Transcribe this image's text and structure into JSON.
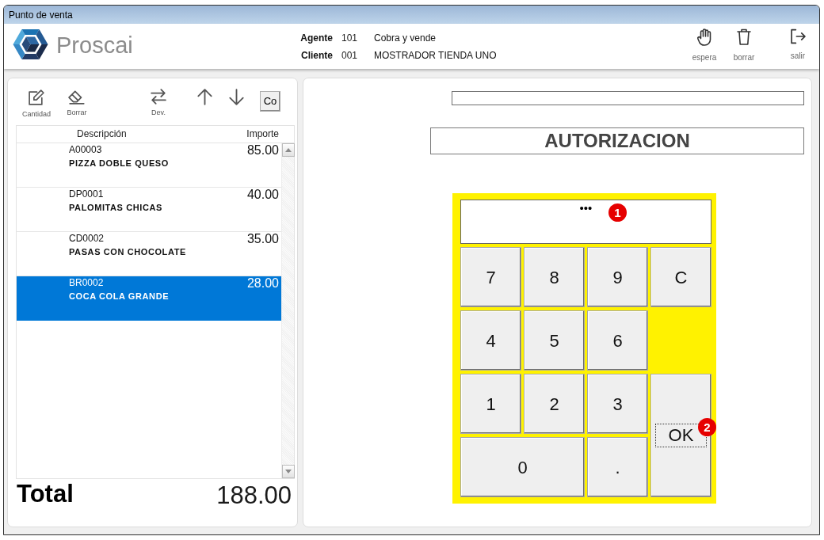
{
  "window": {
    "title": "Punto de venta"
  },
  "header": {
    "brand": "Proscai",
    "info": [
      {
        "label": "Agente",
        "value": "101",
        "detail": "Cobra y vende"
      },
      {
        "label": "Cliente",
        "value": "001",
        "detail": "MOSTRADOR TIENDA UNO"
      }
    ],
    "actions": [
      {
        "kind": "hand",
        "label": "espera"
      },
      {
        "kind": "trash",
        "label": "borrar"
      },
      {
        "kind": "exit",
        "label": "salir"
      }
    ]
  },
  "toolbar": [
    {
      "kind": "edit",
      "label": "Cantidad"
    },
    {
      "kind": "eraser",
      "label": "Borrar"
    },
    {
      "kind": "swap",
      "label": "Dev."
    },
    {
      "kind": "up"
    },
    {
      "kind": "down"
    },
    {
      "kind": "text",
      "label": "Co"
    }
  ],
  "table": {
    "columns": [
      "Descripción",
      "Importe"
    ],
    "rows": [
      {
        "code": "A00003",
        "name": "PIZZA DOBLE QUESO",
        "amount": "85.00",
        "selected": false
      },
      {
        "code": "DP0001",
        "name": "PALOMITAS CHICAS",
        "amount": "40.00",
        "selected": false
      },
      {
        "code": "CD0002",
        "name": "PASAS CON CHOCOLATE",
        "amount": "35.00",
        "selected": false
      },
      {
        "code": "BR0002",
        "name": "COCA COLA GRANDE",
        "amount": "28.00",
        "selected": true
      }
    ]
  },
  "total": {
    "label": "Total",
    "value": "188.00"
  },
  "authorization": {
    "title": "AUTORIZACION",
    "display": {
      "value": "•••",
      "annotation": "1"
    },
    "key_rows": [
      [
        {
          "label": "7",
          "kind": "digit",
          "focused": false
        },
        {
          "label": "8",
          "kind": "digit",
          "focused": false
        },
        {
          "label": "9",
          "kind": "digit",
          "focused": false
        },
        {
          "label": "C",
          "kind": "clear",
          "focused": false
        }
      ],
      [
        {
          "label": "4",
          "kind": "digit",
          "focused": false
        },
        {
          "label": "5",
          "kind": "digit",
          "focused": false
        },
        {
          "label": "6",
          "kind": "digit",
          "focused": false
        }
      ],
      [
        {
          "label": "1",
          "kind": "digit",
          "focused": false
        },
        {
          "label": "2",
          "kind": "digit",
          "focused": false
        },
        {
          "label": "3",
          "kind": "digit",
          "focused": false
        },
        {
          "label": "OK",
          "kind": "enter",
          "focused": true,
          "annotation": "2"
        }
      ],
      [
        {
          "label": "0",
          "kind": "zero",
          "focused": false
        },
        {
          "label": ".",
          "kind": "decimal",
          "focused": false
        }
      ]
    ]
  }
}
